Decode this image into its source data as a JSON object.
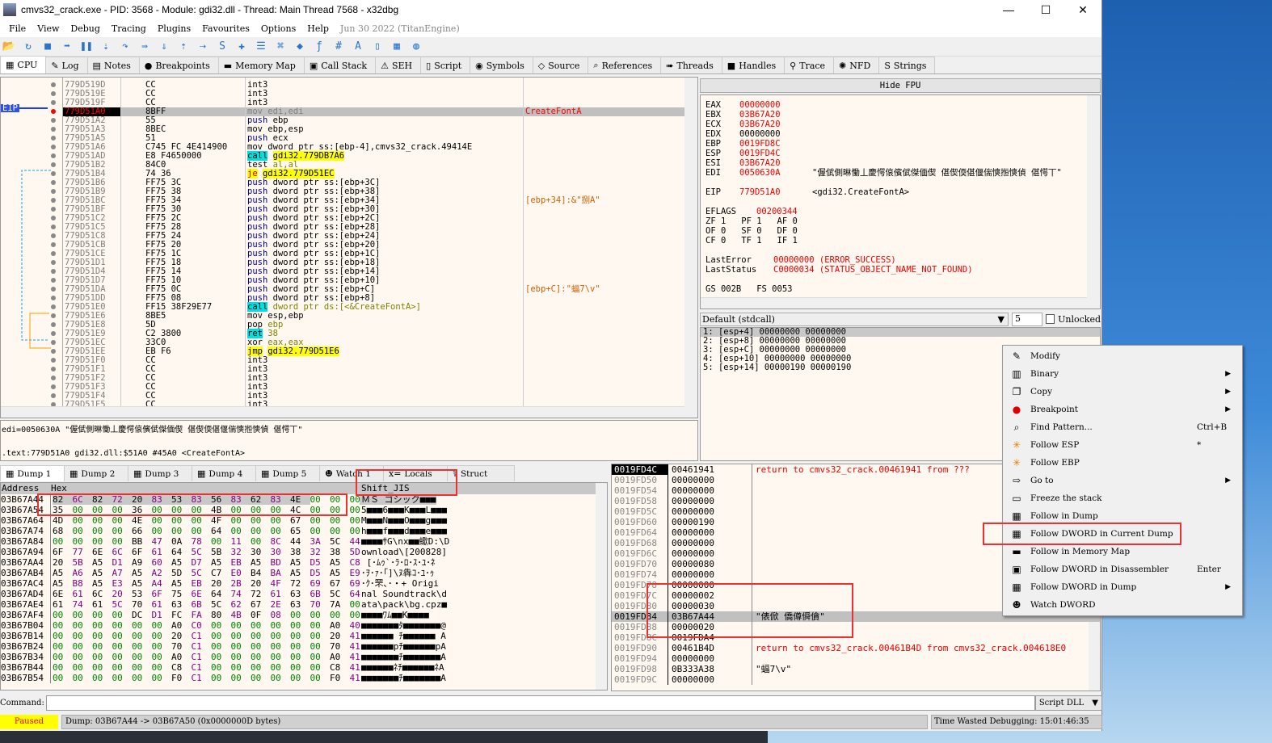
{
  "title": "cmvs32_crack.exe - PID: 3568 - Module: gdi32.dll - Thread: Main Thread 7568 - x32dbg",
  "menu": [
    "File",
    "View",
    "Debug",
    "Tracing",
    "Plugins",
    "Favourites",
    "Options",
    "Help"
  ],
  "build_date": "Jun 30 2022 (TitanEngine)",
  "toolbar_icons": [
    "open-icon",
    "restart-icon",
    "stop-icon",
    "run-icon",
    "pause-icon",
    "step-into-icon",
    "step-over-icon",
    "trace-into-icon",
    "trace-over-icon",
    "execute-till-return-icon",
    "run-to-user-code-icon",
    "scylla-icon",
    "patch-icon",
    "comment-icon",
    "label-icon",
    "bookmark-icon",
    "function-icon",
    "hash-icon",
    "font-icon",
    "device-icon",
    "calculator-icon",
    "globe-icon"
  ],
  "tabs": [
    {
      "label": "CPU",
      "icon": "▦"
    },
    {
      "label": "Log",
      "icon": "✎"
    },
    {
      "label": "Notes",
      "icon": "▤"
    },
    {
      "label": "Breakpoints",
      "icon": "●"
    },
    {
      "label": "Memory Map",
      "icon": "▬"
    },
    {
      "label": "Call Stack",
      "icon": "▣"
    },
    {
      "label": "SEH",
      "icon": "⚠"
    },
    {
      "label": "Script",
      "icon": "▯"
    },
    {
      "label": "Symbols",
      "icon": "◉"
    },
    {
      "label": "Source",
      "icon": "◇"
    },
    {
      "label": "References",
      "icon": "⌕"
    },
    {
      "label": "Threads",
      "icon": "➠"
    },
    {
      "label": "Handles",
      "icon": "■"
    },
    {
      "label": "Trace",
      "icon": "⚲"
    },
    {
      "label": "NFD",
      "icon": "✺"
    },
    {
      "label": "Strings",
      "icon": "S"
    }
  ],
  "eip_label": "EIP",
  "disasm": [
    {
      "a": "779D519D",
      "b": "CC",
      "m": "int3",
      "o": "",
      "c": ""
    },
    {
      "a": "779D519E",
      "b": "CC",
      "m": "int3",
      "o": "",
      "c": ""
    },
    {
      "a": "779D519F",
      "b": "CC",
      "m": "int3",
      "o": "",
      "c": ""
    },
    {
      "a": "779D51A0",
      "b": "8BFF",
      "m": "mov",
      "o": "edi,edi",
      "c": "CreateFontA",
      "eip": true
    },
    {
      "a": "779D51A2",
      "b": "55",
      "m": "push",
      "o": "ebp",
      "c": ""
    },
    {
      "a": "779D51A3",
      "b": "8BEC",
      "m": "mov",
      "o": "ebp,esp",
      "c": ""
    },
    {
      "a": "779D51A5",
      "b": "51",
      "m": "push",
      "o": "ecx",
      "c": ""
    },
    {
      "a": "779D51A6",
      "b": "C745 FC 4E414900",
      "m": "mov",
      "o": "dword ptr ss:[ebp-4],cmvs32_crack.49414E",
      "c": ""
    },
    {
      "a": "779D51AD",
      "b": "E8 F4650000",
      "m": "call",
      "o": "gdi32.779DB7A6",
      "c": "",
      "t": true
    },
    {
      "a": "779D51B2",
      "b": "84C0",
      "m": "test",
      "o": "al,al",
      "c": ""
    },
    {
      "a": "779D51B4",
      "b": "74 36",
      "m": "je",
      "o": "gdi32.779D51EC",
      "c": "",
      "t": true
    },
    {
      "a": "779D51B6",
      "b": "FF75 3C",
      "m": "push",
      "o": "dword ptr ss:[ebp+3C]",
      "c": ""
    },
    {
      "a": "779D51B9",
      "b": "FF75 38",
      "m": "push",
      "o": "dword ptr ss:[ebp+38]",
      "c": ""
    },
    {
      "a": "779D51BC",
      "b": "FF75 34",
      "m": "push",
      "o": "dword ptr ss:[ebp+34]",
      "c": "[ebp+34]:&\"捌A\""
    },
    {
      "a": "779D51BF",
      "b": "FF75 30",
      "m": "push",
      "o": "dword ptr ss:[ebp+30]",
      "c": ""
    },
    {
      "a": "779D51C2",
      "b": "FF75 2C",
      "m": "push",
      "o": "dword ptr ss:[ebp+2C]",
      "c": ""
    },
    {
      "a": "779D51C5",
      "b": "FF75 28",
      "m": "push",
      "o": "dword ptr ss:[ebp+28]",
      "c": ""
    },
    {
      "a": "779D51C8",
      "b": "FF75 24",
      "m": "push",
      "o": "dword ptr ss:[ebp+24]",
      "c": ""
    },
    {
      "a": "779D51CB",
      "b": "FF75 20",
      "m": "push",
      "o": "dword ptr ss:[ebp+20]",
      "c": ""
    },
    {
      "a": "779D51CE",
      "b": "FF75 1C",
      "m": "push",
      "o": "dword ptr ss:[ebp+1C]",
      "c": ""
    },
    {
      "a": "779D51D1",
      "b": "FF75 18",
      "m": "push",
      "o": "dword ptr ss:[ebp+18]",
      "c": ""
    },
    {
      "a": "779D51D4",
      "b": "FF75 14",
      "m": "push",
      "o": "dword ptr ss:[ebp+14]",
      "c": ""
    },
    {
      "a": "779D51D7",
      "b": "FF75 10",
      "m": "push",
      "o": "dword ptr ss:[ebp+10]",
      "c": ""
    },
    {
      "a": "779D51DA",
      "b": "FF75 0C",
      "m": "push",
      "o": "dword ptr ss:[ebp+C]",
      "c": "[ebp+C]:\"蝠7\\v\""
    },
    {
      "a": "779D51DD",
      "b": "FF75 08",
      "m": "push",
      "o": "dword ptr ss:[ebp+8]",
      "c": ""
    },
    {
      "a": "779D51E0",
      "b": "FF15 38F29E77",
      "m": "call",
      "o": "dword ptr ds:[<&CreateFontA>]",
      "c": ""
    },
    {
      "a": "779D51E6",
      "b": "8BE5",
      "m": "mov",
      "o": "esp,ebp",
      "c": ""
    },
    {
      "a": "779D51E8",
      "b": "5D",
      "m": "pop",
      "o": "ebp",
      "c": ""
    },
    {
      "a": "779D51E9",
      "b": "C2 3800",
      "m": "ret",
      "o": "38",
      "c": ""
    },
    {
      "a": "779D51EC",
      "b": "33C0",
      "m": "xor",
      "o": "eax,eax",
      "c": ""
    },
    {
      "a": "779D51EE",
      "b": "EB F6",
      "m": "jmp",
      "o": "gdi32.779D51E6",
      "c": "",
      "t": true
    },
    {
      "a": "779D51F0",
      "b": "CC",
      "m": "int3",
      "o": "",
      "c": ""
    },
    {
      "a": "779D51F1",
      "b": "CC",
      "m": "int3",
      "o": "",
      "c": ""
    },
    {
      "a": "779D51F2",
      "b": "CC",
      "m": "int3",
      "o": "",
      "c": ""
    },
    {
      "a": "779D51F3",
      "b": "CC",
      "m": "int3",
      "o": "",
      "c": ""
    },
    {
      "a": "779D51F4",
      "b": "CC",
      "m": "int3",
      "o": "",
      "c": ""
    },
    {
      "a": "779D51F5",
      "b": "CC",
      "m": "int3",
      "o": "",
      "c": ""
    }
  ],
  "info": {
    "line1": "edi=0050630A \"偓倵側晽慟丄慶愕偯儐倵傑偭偰 偡偰偄偡偃偳慡搄慡偵 偡愕丅\"",
    "line2": ".text:779D51A0 gdi32.dll:$51A0 #45A0 <CreateFontA>"
  },
  "fpu_toggle": "Hide FPU",
  "registers": [
    {
      "n": "EAX",
      "v": "00000000",
      "c": ""
    },
    {
      "n": "EBX",
      "v": "03B67A20",
      "c": ""
    },
    {
      "n": "ECX",
      "v": "03B67A20",
      "c": ""
    },
    {
      "n": "EDX",
      "v": "00000000",
      "c": ""
    },
    {
      "n": "EBP",
      "v": "0019FD8C",
      "c": ""
    },
    {
      "n": "ESP",
      "v": "0019FD4C",
      "c": ""
    },
    {
      "n": "ESI",
      "v": "03B67A20",
      "c": ""
    },
    {
      "n": "EDI",
      "v": "0050630A",
      "c": "\"偓倵側晽慟丄慶愕偯儐倵傑偭偰 偡偰偄偡偃偳慡搄慡偵 偡愕丅\""
    }
  ],
  "eip": {
    "n": "EIP",
    "v": "779D51A0",
    "c": "<gdi32.CreateFontA>"
  },
  "eflags": {
    "n": "EFLAGS",
    "v": "00200344"
  },
  "flags": [
    "ZF 1   PF 1   AF 0",
    "OF 0   SF 0   DF 0",
    "CF 0   TF 1   IF 1"
  ],
  "last_error": {
    "n": "LastError",
    "v": "00000000 (ERROR_SUCCESS)"
  },
  "last_status": {
    "n": "LastStatus",
    "v": "C0000034 (STATUS_OBJECT_NAME_NOT_FOUND)"
  },
  "segs": "GS 002B   FS 0053",
  "callconv": {
    "value": "Default (stdcall)",
    "count": "5",
    "unlocked": "Unlocked"
  },
  "args": [
    "1: [esp+4] 00000000 00000000",
    "2: [esp+8] 00000000 00000000",
    "3: [esp+C] 00000000 00000000",
    "4: [esp+10] 00000000 00000000",
    "5: [esp+14] 00000190 00000190"
  ],
  "dump_tabs": [
    "Dump 1",
    "Dump 2",
    "Dump 3",
    "Dump 4",
    "Dump 5",
    "Watch 1",
    "Locals",
    "Struct"
  ],
  "dump_headers": {
    "address": "Address",
    "hex": "Hex",
    "text": "Shift_JIS"
  },
  "dump": [
    {
      "a": "03B67A44",
      "h": "82 6C 82 72 20 83 53 83 56 83 62 83 4E 00 00 00",
      "t": "ＭＳ ゴシック■■■"
    },
    {
      "a": "03B67A54",
      "h": "35 00 00 00 36 00 00 00 4B 00 00 00 4C 00 00 00",
      "t": "5■■■6■■■K■■■L■■■"
    },
    {
      "a": "03B67A64",
      "h": "4D 00 00 00 4E 00 00 00 4F 00 00 00 67 00 00 00",
      "t": "M■■■N■■■O■■■g■■■"
    },
    {
      "a": "03B67A74",
      "h": "68 00 00 00 66 00 00 00 64 00 00 00 65 00 00 00",
      "t": "h■■■f■■■d■■■e■■■"
    },
    {
      "a": "03B67A84",
      "h": "00 00 00 00 BB 47 0A 78 00 11 00 8C 44 3A 5C 44",
      "t": "■■■■ｻG\\nx■■蠍D:\\D"
    },
    {
      "a": "03B67A94",
      "h": "6F 77 6E 6C 6F 61 64 5C 5B 32 30 30 38 32 38 5D",
      "t": "ownload\\[200828]"
    },
    {
      "a": "03B67AA4",
      "h": "20 5B A5 D1 A9 60 A5 D7 A5 EB A5 BD A5 D5 A5 C8",
      "t": " [･ﾑｩ`･ﾗ･ﾛ･ｽ･ﾕ･ﾈ"
    },
    {
      "a": "03B67AB4",
      "h": "A5 A6 A5 A7 A5 A2 5D 5C C7 E0 B4 BA A5 D5 A5 E9",
      "t": "･ｦ･ｧ･｢]\\ﾇ犇ｺ･ﾕ･ｩ"
    },
    {
      "a": "03B67AC4",
      "h": "A5 B8 A5 E3 A5 A4 A5 EB 20 2B 20 4F 72 69 67 69",
      "t": "･ｸ･罘､･・+ Origi"
    },
    {
      "a": "03B67AD4",
      "h": "6E 61 6C 20 53 6F 75 6E 64 74 72 61 63 6B 5C 64",
      "t": "nal Soundtrack\\d"
    },
    {
      "a": "03B67AE4",
      "h": "61 74 61 5C 70 61 63 6B 5C 62 67 2E 63 70 7A 00",
      "t": "ata\\pack\\bg.cpz■"
    },
    {
      "a": "03B67AF4",
      "h": "00 00 00 00 DC D1 FC FA 80 4B 0F 08 00 00 00 00",
      "t": "■■■■ﾜﾑ■■K■■■■"
    },
    {
      "a": "03B67B04",
      "h": "00 00 00 00 00 00 A0 C0 00 00 00 00 00 00 A0 40",
      "t": "■■■■■■■ﾀ■■■■■■■@"
    },
    {
      "a": "03B67B14",
      "h": "00 00 00 00 00 00 20 C1 00 00 00 00 00 00 20 41",
      "t": "■■■■■■ ﾁ■■■■■■ A"
    },
    {
      "a": "03B67B24",
      "h": "00 00 00 00 00 00 70 C1 00 00 00 00 00 00 70 41",
      "t": "■■■■■■pﾁ■■■■■■pA"
    },
    {
      "a": "03B67B34",
      "h": "00 00 00 00 00 00 A0 C1 00 00 00 00 00 00 A0 41",
      "t": "■■■■■■■ﾁ■■■■■■■A"
    },
    {
      "a": "03B67B44",
      "h": "00 00 00 00 00 00 C8 C1 00 00 00 00 00 00 C8 41",
      "t": "■■■■■■ﾈﾁ■■■■■■ﾈA"
    },
    {
      "a": "03B67B54",
      "h": "00 00 00 00 00 00 F0 C1 00 00 00 00 00 00 F0 41",
      "t": "■■■■■■■ﾁ■■■■■■■A"
    }
  ],
  "stack": [
    {
      "a": "0019FD4C",
      "v": "00461941",
      "c": "return to cmvs32_crack.00461941 from ???",
      "ret": true,
      "top": true
    },
    {
      "a": "0019FD50",
      "v": "00000000",
      "c": ""
    },
    {
      "a": "0019FD54",
      "v": "00000000",
      "c": ""
    },
    {
      "a": "0019FD58",
      "v": "00000000",
      "c": ""
    },
    {
      "a": "0019FD5C",
      "v": "00000000",
      "c": ""
    },
    {
      "a": "0019FD60",
      "v": "00000190",
      "c": ""
    },
    {
      "a": "0019FD64",
      "v": "00000000",
      "c": ""
    },
    {
      "a": "0019FD68",
      "v": "00000000",
      "c": ""
    },
    {
      "a": "0019FD6C",
      "v": "00000000",
      "c": ""
    },
    {
      "a": "0019FD70",
      "v": "00000080",
      "c": ""
    },
    {
      "a": "0019FD74",
      "v": "00000000",
      "c": ""
    },
    {
      "a": "0019FD78",
      "v": "00000000",
      "c": ""
    },
    {
      "a": "0019FD7C",
      "v": "00000002",
      "c": ""
    },
    {
      "a": "0019FD80",
      "v": "00000030",
      "c": ""
    },
    {
      "a": "0019FD84",
      "v": "03B67A44",
      "c": "\"俵俽 僑僔僢僋\"",
      "sel": true
    },
    {
      "a": "0019FD88",
      "v": "00000020",
      "c": ""
    },
    {
      "a": "0019FD8C",
      "v": "0019FDA4",
      "c": ""
    },
    {
      "a": "0019FD90",
      "v": "00461B4D",
      "c": "return to cmvs32_crack.00461B4D from cmvs32_crack.004618E0",
      "ret": true
    },
    {
      "a": "0019FD94",
      "v": "00000000",
      "c": ""
    },
    {
      "a": "0019FD98",
      "v": "0B333A38",
      "c": "\"蝠7\\v\""
    },
    {
      "a": "0019FD9C",
      "v": "00000000",
      "c": ""
    }
  ],
  "context_menu": [
    {
      "label": "Modify",
      "icon": "✎",
      "name": "pencil-icon"
    },
    {
      "label": "Binary",
      "icon": "▥",
      "name": "binary-icon",
      "sub": true
    },
    {
      "label": "Copy",
      "icon": "❐",
      "name": "copy-icon",
      "sub": true
    },
    {
      "label": "Breakpoint",
      "icon": "●",
      "name": "breakpoint-icon",
      "sub": true
    },
    {
      "label": "Find Pattern...",
      "icon": "⌕",
      "name": "find-icon",
      "shortcut": "Ctrl+B"
    },
    {
      "label": "Follow ESP",
      "icon": "✳",
      "name": "follow-esp-icon",
      "shortcut": "*"
    },
    {
      "label": "Follow EBP",
      "icon": "✳",
      "name": "follow-ebp-icon"
    },
    {
      "label": "Go to",
      "icon": "⇨",
      "name": "goto-icon",
      "sub": true
    },
    {
      "label": "Freeze the stack",
      "icon": "▭",
      "name": "freeze-icon"
    },
    {
      "label": "Follow in Dump",
      "icon": "▦",
      "name": "dump-icon"
    },
    {
      "label": "Follow DWORD in Current Dump",
      "icon": "▦",
      "name": "dump-icon"
    },
    {
      "label": "Follow in Memory Map",
      "icon": "▬",
      "name": "memory-map-icon"
    },
    {
      "label": "Follow DWORD in Disassembler",
      "icon": "▣",
      "name": "cpu-icon",
      "shortcut": "Enter"
    },
    {
      "label": "Follow DWORD in Dump",
      "icon": "▦",
      "name": "dump-icon",
      "sub": true
    },
    {
      "label": "Watch DWORD",
      "icon": "☻",
      "name": "watch-icon"
    }
  ],
  "command": {
    "label": "Command:",
    "value": "",
    "script": "Script DLL"
  },
  "status": {
    "state": "Paused",
    "message": "Dump: 03B67A44 -> 03B67A50 (0x0000000D bytes)",
    "time": "Time Wasted Debugging: 15:01:46:35"
  }
}
